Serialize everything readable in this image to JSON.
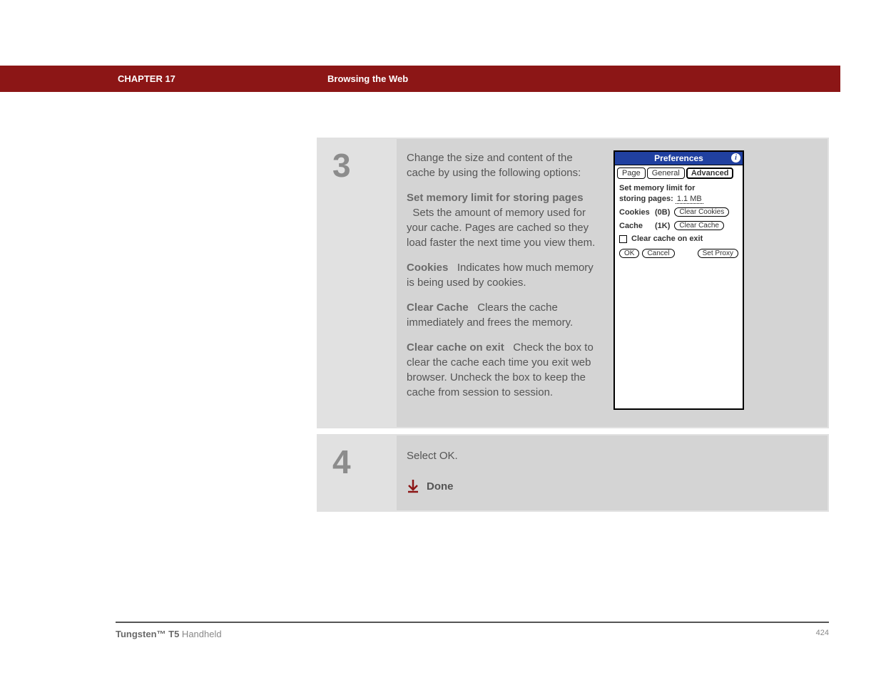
{
  "header": {
    "chapter": "CHAPTER 17",
    "title": "Browsing the Web"
  },
  "steps": {
    "step3": {
      "number": "3",
      "intro": "Change the size and content of the cache by using the following options:",
      "options": [
        {
          "label": "Set memory limit for storing pages",
          "desc": "Sets the amount of memory used for your cache. Pages are cached so they load faster the next time you view them."
        },
        {
          "label": "Cookies",
          "desc": "Indicates how much memory is being used by cookies."
        },
        {
          "label": "Clear Cache",
          "desc": "Clears the cache immediately and frees the memory."
        },
        {
          "label": "Clear cache on exit",
          "desc": "Check the box to clear the cache each time you exit web browser. Uncheck the box to keep the cache from session to session."
        }
      ]
    },
    "step4": {
      "number": "4",
      "text": "Select OK.",
      "done": "Done"
    }
  },
  "prefs": {
    "title": "Preferences",
    "info_glyph": "i",
    "tabs": {
      "page": "Page",
      "general": "General",
      "advanced": "Advanced"
    },
    "mem_label_1": "Set memory limit for",
    "mem_label_2": "storing pages:",
    "mem_value": "1.1 MB",
    "cookies_label": "Cookies",
    "cookies_size": "(0B)",
    "clear_cookies": "Clear Cookies",
    "cache_label": "Cache",
    "cache_size": "(1K)",
    "clear_cache": "Clear Cache",
    "clear_on_exit": "Clear cache on exit",
    "ok": "OK",
    "cancel": "Cancel",
    "set_proxy": "Set Proxy"
  },
  "footer": {
    "product_bold": "Tungsten™ T5",
    "product_rest": " Handheld",
    "page": "424"
  }
}
